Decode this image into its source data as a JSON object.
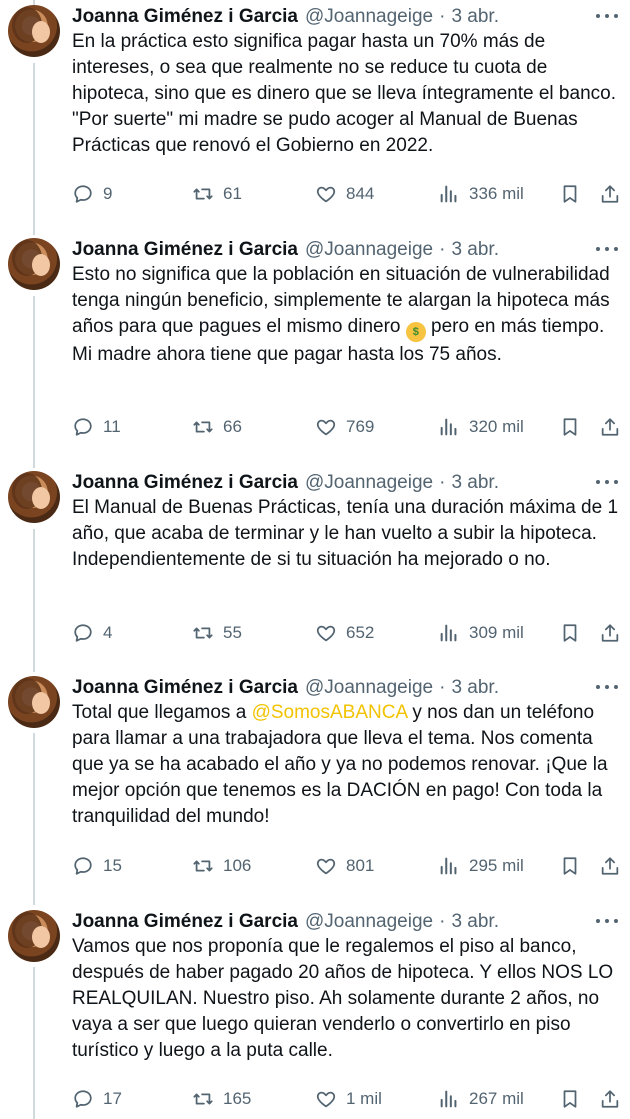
{
  "author": {
    "name": "Joanna Giménez i Garcia",
    "handle": "@Joannageige"
  },
  "separator": "·",
  "accent_colors": {
    "mention": "#f2c300",
    "thread_line": "#cfd9de",
    "muted": "#536471"
  },
  "icons": {
    "reply": "comment-bubble-icon",
    "retweet": "retweet-icon",
    "like": "heart-icon",
    "views": "bar-chart-icon",
    "bookmark": "bookmark-icon",
    "share": "share-upload-icon",
    "more": "more-dots-icon",
    "emoji": "money-mouth-face-emoji"
  },
  "tweets": [
    {
      "date": "3 abr.",
      "text": "En la práctica esto significa pagar hasta un 70% más de intereses, o sea que realmente no se reduce tu cuota de hipoteca, sino que es dinero que se lleva íntegramente el banco. \"Por suerte\" mi madre se pudo acoger al Manual de Buenas Prácticas que renovó el Gobierno en 2022.",
      "replies": "9",
      "retweets": "61",
      "likes": "844",
      "views": "336 mil"
    },
    {
      "date": "3 abr.",
      "text_before_emoji": "Esto no significa que la población en situación de vulnerabilidad tenga ningún beneficio, simplemente te alargan la hipoteca más años para que pagues el mismo dinero ",
      "text_after_emoji": " pero en más tiempo. Mi madre ahora tiene que pagar hasta los 75 años.",
      "emoji_glyph": "$",
      "replies": "11",
      "retweets": "66",
      "likes": "769",
      "views": "320 mil"
    },
    {
      "date": "3 abr.",
      "text": "El Manual de Buenas Prácticas, tenía una duración máxima de 1 año, que acaba de terminar y le han vuelto a subir la hipoteca. Independientemente de si tu situación ha mejorado o no.",
      "replies": "4",
      "retweets": "55",
      "likes": "652",
      "views": "309 mil"
    },
    {
      "date": "3 abr.",
      "text_before_mention": "Total que llegamos a ",
      "mention": "@SomosABANCA",
      "text_after_mention": " y nos dan un teléfono para llamar a una trabajadora que lleva el tema. Nos comenta que ya se ha acabado el año y ya no podemos renovar. ¡Que la mejor opción que tenemos es la DACIÓN en pago! Con toda la tranquilidad del mundo!",
      "replies": "15",
      "retweets": "106",
      "likes": "801",
      "views": "295 mil"
    },
    {
      "date": "3 abr.",
      "text": "Vamos que nos proponía que le regalemos el piso al banco, después de haber pagado 20 años de hipoteca. Y ellos NOS LO REALQUILAN. Nuestro piso. Ah solamente durante 2 años, no vaya a ser que luego quieran venderlo o convertirlo en piso turístico y luego a la puta calle.",
      "replies": "17",
      "retweets": "165",
      "likes": "1 mil",
      "views": "267 mil"
    }
  ]
}
